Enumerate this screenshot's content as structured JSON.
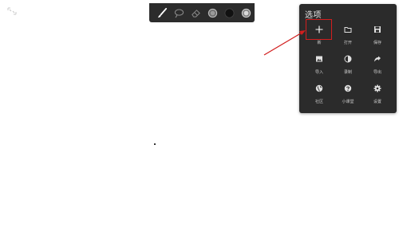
{
  "toolbar": {
    "tools": [
      {
        "icon": "brush-icon"
      },
      {
        "icon": "lasso-icon"
      },
      {
        "icon": "eraser-icon"
      },
      {
        "icon": "brush-size-icon"
      },
      {
        "icon": "color-swatch-icon",
        "color": "#111111"
      },
      {
        "icon": "opacity-icon"
      }
    ]
  },
  "options_panel": {
    "title": "选项",
    "items": [
      {
        "label": "新",
        "icon": "plus-icon"
      },
      {
        "label": "打开",
        "icon": "folder-icon"
      },
      {
        "label": "保存",
        "icon": "save-icon"
      },
      {
        "label": "导入",
        "icon": "image-icon"
      },
      {
        "label": "录制",
        "icon": "record-icon"
      },
      {
        "label": "导出",
        "icon": "share-icon"
      },
      {
        "label": "社区",
        "icon": "globe-icon"
      },
      {
        "label": "小课堂",
        "icon": "help-icon"
      },
      {
        "label": "设置",
        "icon": "gear-icon"
      }
    ]
  },
  "colors": {
    "panel_bg": "#2b2b2b",
    "highlight": "#d21f1f",
    "canvas_bg": "#ffffff"
  }
}
